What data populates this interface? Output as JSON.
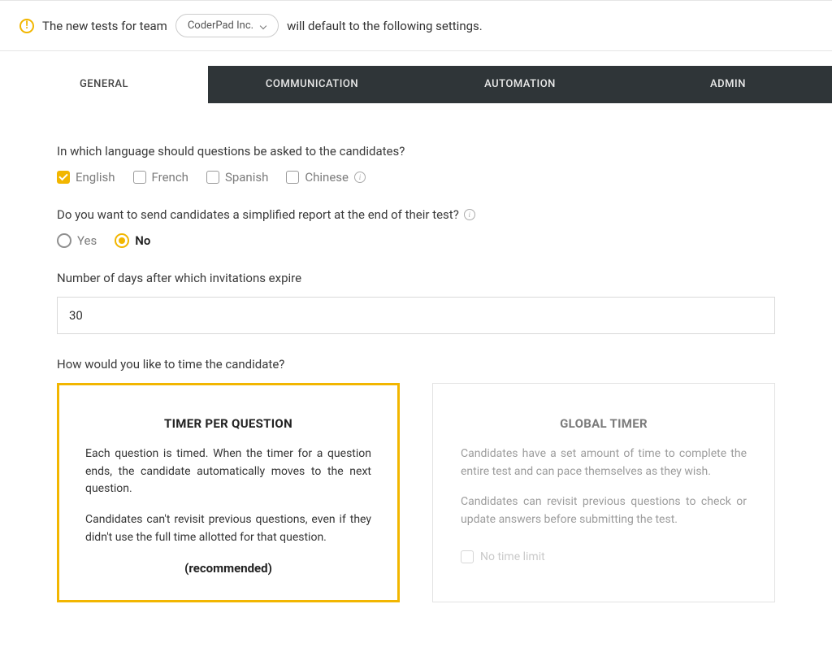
{
  "banner": {
    "prefix": "The new tests for team",
    "team": "CoderPad Inc.",
    "suffix": "will default to the following settings."
  },
  "tabs": {
    "general": "GENERAL",
    "communication": "COMMUNICATION",
    "automation": "AUTOMATION",
    "admin": "ADMIN"
  },
  "language": {
    "question": "In which language should questions be asked to the candidates?",
    "options": {
      "english": "English",
      "french": "French",
      "spanish": "Spanish",
      "chinese": "Chinese"
    }
  },
  "report": {
    "question": "Do you want to send candidates a simplified report at the end of their test?",
    "yes": "Yes",
    "no": "No"
  },
  "expiry": {
    "question": "Number of days after which invitations expire",
    "value": "30"
  },
  "timer": {
    "question": "How would you like to time the candidate?",
    "per_question": {
      "title": "TIMER PER QUESTION",
      "p1": "Each question is timed. When the timer for a question ends, the candidate automatically moves to the next question.",
      "p2": "Candidates can't revisit previous questions, even if they didn't use the full time allotted for that question.",
      "recommended": "(recommended)"
    },
    "global": {
      "title": "GLOBAL TIMER",
      "p1": "Candidates have a set amount of time to complete the entire test and can pace themselves as they wish.",
      "p2": "Candidates can revisit previous questions to check or update answers before submitting the test.",
      "no_limit": "No time limit"
    }
  }
}
